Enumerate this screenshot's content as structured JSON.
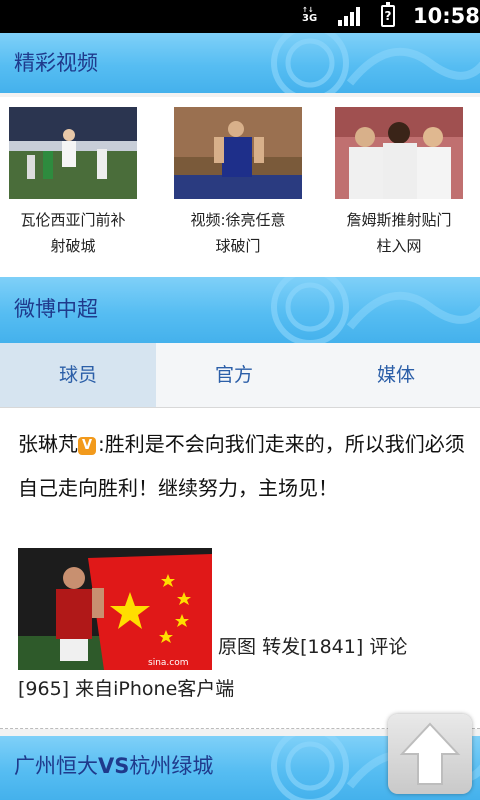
{
  "status_bar": {
    "network": "3G",
    "time": "10:58"
  },
  "sections": {
    "videos_title": "精彩视频",
    "weibo_title": "微博中超",
    "match_title_home": "广州恒大",
    "match_title_vs": "VS",
    "match_title_away": "杭州绿城"
  },
  "videos": [
    {
      "title_line1": "瓦伦西亚门前补",
      "title_line2": "射破城"
    },
    {
      "title_line1": "视频:徐亮任意",
      "title_line2": "球破门"
    },
    {
      "title_line1": "詹姆斯推射贴门",
      "title_line2": "柱入网"
    }
  ],
  "tabs": [
    {
      "label": "球员",
      "active": true
    },
    {
      "label": "官方",
      "active": false
    },
    {
      "label": "媒体",
      "active": false
    }
  ],
  "post": {
    "author": "张琳芃",
    "verified_badge": "V",
    "text": ":胜利是不会向我们走来的，所以我们必须自己走向胜利！继续努力，主场见！",
    "original_image": "原图",
    "repost_label": "转发",
    "repost_count": "[1841]",
    "comment_label": "评论",
    "comment_count": "[965]",
    "source": "来自iPhone客户端"
  },
  "colors": {
    "header_blue": "#56bdf2",
    "header_text": "#1f3a8c",
    "tab_text": "#2c5fa8",
    "active_tab_bg": "#d6e4f0",
    "verified_badge": "#f29a1c"
  },
  "icons": {
    "scroll_top": "arrow-up-icon"
  }
}
